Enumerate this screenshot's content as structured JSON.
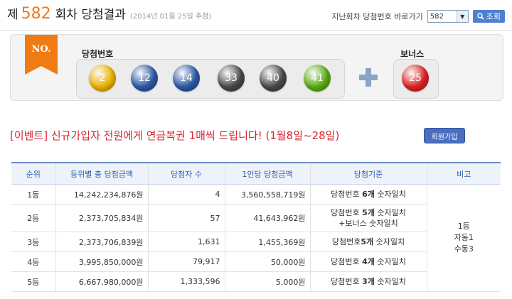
{
  "header": {
    "prefix": "제",
    "round": "582",
    "suffix": "회차 당첨결과",
    "date": "(2014년 01월 25일 추첨)"
  },
  "nav": {
    "label": "지난회차 당첨번호 바로가기",
    "select_value": "582",
    "button_label": "조회"
  },
  "result": {
    "ribbon_label": "NO.",
    "winning_label": "당첨번호",
    "bonus_label": "보너스",
    "numbers": [
      {
        "value": "2",
        "color": "#f0b400"
      },
      {
        "value": "12",
        "color": "#2c5aa8"
      },
      {
        "value": "14",
        "color": "#2c5aa8"
      },
      {
        "value": "33",
        "color": "#4a4a4a"
      },
      {
        "value": "40",
        "color": "#4a4a4a"
      },
      {
        "value": "41",
        "color": "#5cae12"
      }
    ],
    "bonus": {
      "value": "25",
      "color": "#e02424"
    }
  },
  "event": {
    "text": "[이벤트] 신규가입자 전원에게 연금복권 1매씩 드립니다! (1월8일~28일)",
    "join_button": "회원가입"
  },
  "table": {
    "headers": [
      "순위",
      "등위별 총 당첨금액",
      "당첨자 수",
      "1인당 당첨금액",
      "당첨기준",
      "비고"
    ],
    "rows": [
      {
        "rank": "1등",
        "total": "14,242,234,876원",
        "winners": "4",
        "per": "3,560,558,719원",
        "crit_a": "당첨번호 ",
        "crit_b": "6개",
        "crit_c": " 숫자일치",
        "crit2": ""
      },
      {
        "rank": "2등",
        "total": "2,373,705,834원",
        "winners": "57",
        "per": "41,643,962원",
        "crit_a": "당첨번호 ",
        "crit_b": "5개",
        "crit_c": " 숫자일치",
        "crit2": "+보너스 숫자일치"
      },
      {
        "rank": "3등",
        "total": "2,373,706,839원",
        "winners": "1,631",
        "per": "1,455,369원",
        "crit_a": "당첨번호",
        "crit_b": "5개",
        "crit_c": " 숫자일치",
        "crit2": ""
      },
      {
        "rank": "4등",
        "total": "3,995,850,000원",
        "winners": "79,917",
        "per": "50,000원",
        "crit_a": "당첨번호 ",
        "crit_b": "4개",
        "crit_c": " 숫자일치",
        "crit2": ""
      },
      {
        "rank": "5등",
        "total": "6,667,980,000원",
        "winners": "1,333,596",
        "per": "5,000원",
        "crit_a": "당첨번호 ",
        "crit_b": "3개",
        "crit_c": " 숫자일치",
        "crit2": ""
      }
    ],
    "note": [
      "1등",
      "자동1",
      "수동3"
    ]
  }
}
